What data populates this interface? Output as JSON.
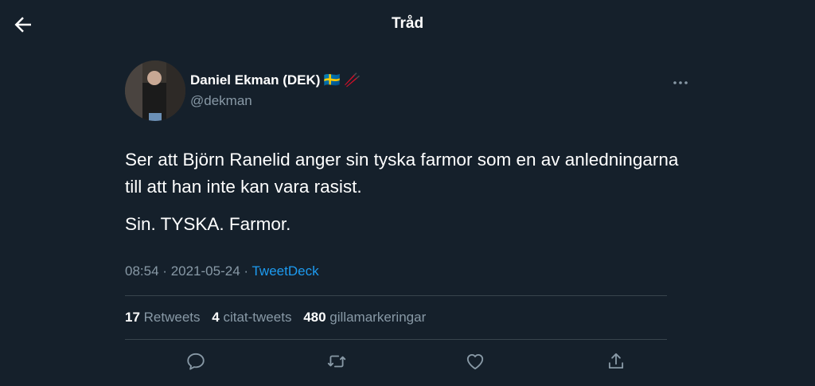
{
  "header": {
    "title": "Tråd",
    "back_icon": "arrow-left-icon"
  },
  "tweet": {
    "author": {
      "name": "Daniel Ekman (DEK)",
      "emoji": "🇸🇪 🥢",
      "handle": "@dekman"
    },
    "body": [
      "Ser att Björn Ranelid anger sin tyska farmor som en av anledningarna till att han inte kan vara rasist.",
      "Sin. TYSKA. Farmor."
    ],
    "time": "08:54",
    "date": "2021-05-24",
    "separator": "·",
    "source": "TweetDeck",
    "stats": [
      {
        "count": "17",
        "label": "Retweets"
      },
      {
        "count": "4",
        "label": "citat-tweets"
      },
      {
        "count": "480",
        "label": "gillamarkeringar"
      }
    ],
    "actions": [
      "reply-icon",
      "retweet-icon",
      "like-icon",
      "share-icon"
    ]
  },
  "colors": {
    "background": "#15202b",
    "text": "#ffffff",
    "secondary": "#8899a6",
    "accent": "#1d9bf0",
    "border": "#38444d"
  }
}
